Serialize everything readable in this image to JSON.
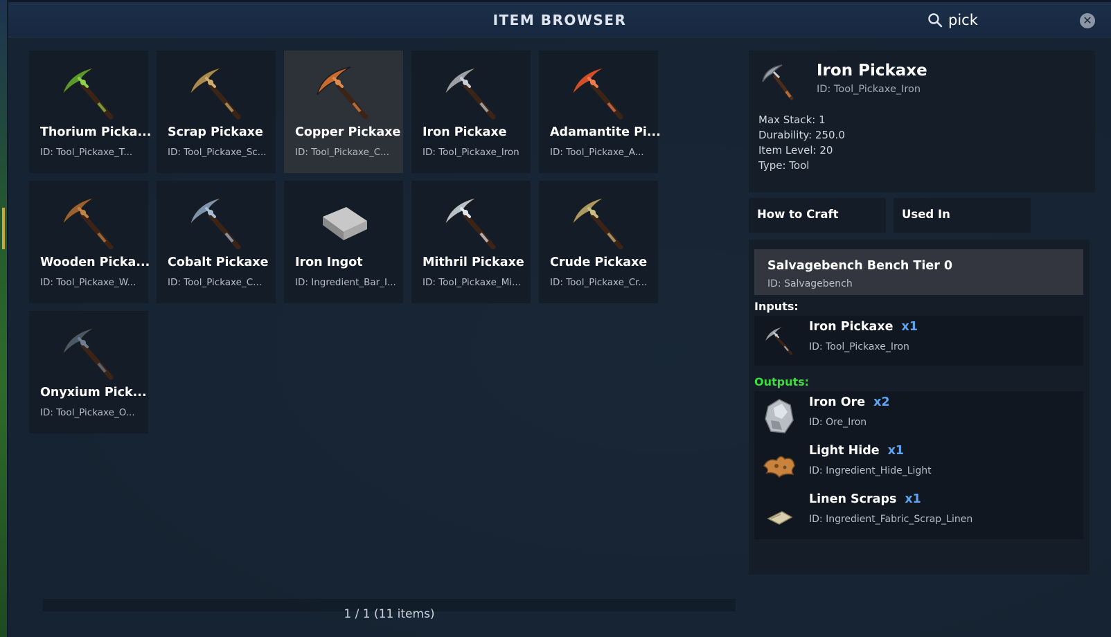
{
  "window": {
    "title": "ITEM BROWSER"
  },
  "search": {
    "value": "pick",
    "icon": "search-icon"
  },
  "grid": {
    "items": [
      {
        "name": "Thorium Picka...",
        "id": "ID: Tool_Pickaxe_T...",
        "head": "#5a9a2c",
        "accent": "#8fd14a",
        "selected": false
      },
      {
        "name": "Scrap Pickaxe",
        "id": "ID: Tool_Pickaxe_Sc...",
        "head": "#a98a50",
        "accent": "#cfae6c",
        "selected": false
      },
      {
        "name": "Copper Pickaxe",
        "id": "ID: Tool_Pickaxe_C...",
        "head": "#c96a30",
        "accent": "#e08a4c",
        "selected": true
      },
      {
        "name": "Iron Pickaxe",
        "id": "ID: Tool_Pickaxe_Iron",
        "head": "#9aa0a8",
        "accent": "#c9ced4",
        "selected": false
      },
      {
        "name": "Adamantite Pi...",
        "id": "ID: Tool_Pickaxe_A...",
        "head": "#d0502c",
        "accent": "#f07a50",
        "selected": false
      },
      {
        "name": "Wooden Picka...",
        "id": "ID: Tool_Pickaxe_W...",
        "head": "#9a6030",
        "accent": "#c48448",
        "selected": false
      },
      {
        "name": "Cobalt Pickaxe",
        "id": "ID: Tool_Pickaxe_C...",
        "head": "#7d93ad",
        "accent": "#a9bdd6",
        "selected": false
      },
      {
        "name": "Iron Ingot",
        "id": "ID: Ingredient_Bar_I...",
        "head": "#9a9a9a",
        "accent": "#c6c6c6",
        "selected": false,
        "kind": "ingot"
      },
      {
        "name": "Mithril Pickaxe",
        "id": "ID: Tool_Pickaxe_Mi...",
        "head": "#b8c0c8",
        "accent": "#e2e8ee",
        "selected": false
      },
      {
        "name": "Crude Pickaxe",
        "id": "ID: Tool_Pickaxe_Cr...",
        "head": "#a89a62",
        "accent": "#cbbd84",
        "selected": false
      },
      {
        "name": "Onyxium Pick...",
        "id": "ID: Tool_Pickaxe_O...",
        "head": "#4a5868",
        "accent": "#6e7e90",
        "selected": false
      }
    ]
  },
  "pagination": {
    "text": "1 / 1 (11 items)"
  },
  "detail": {
    "name": "Iron Pickaxe",
    "id": "ID: Tool_Pickaxe_Iron",
    "stats": [
      "Max Stack: 1",
      "Durability: 250.0",
      "Item Level: 20",
      "Type: Tool"
    ]
  },
  "tabs": {
    "how_to_craft": "How to Craft",
    "used_in": "Used In"
  },
  "recipe": {
    "bench_name": "Salvagebench Bench Tier 0",
    "bench_id": "ID: Salvagebench",
    "inputs_label": "Inputs:",
    "outputs_label": "Outputs:",
    "inputs_color": "#ffffff",
    "outputs_color": "#3ddc3d",
    "qty_color": "#5ea4f0",
    "inputs": [
      {
        "name": "Iron Pickaxe",
        "qty": "x1",
        "id": "ID: Tool_Pickaxe_Iron",
        "icon": "pickaxe-icon"
      }
    ],
    "outputs": [
      {
        "name": "Iron Ore",
        "qty": "x2",
        "id": "ID: Ore_Iron",
        "icon": "ore-icon"
      },
      {
        "name": "Light Hide",
        "qty": "x1",
        "id": "ID: Ingredient_Hide_Light",
        "icon": "hide-icon"
      },
      {
        "name": "Linen Scraps",
        "qty": "x1",
        "id": "ID: Ingredient_Fabric_Scrap_Linen",
        "icon": "fabric-icon"
      }
    ]
  }
}
